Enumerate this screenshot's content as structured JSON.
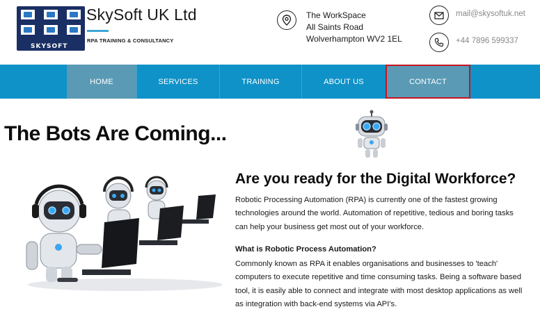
{
  "header": {
    "logo_word": "SKYSOFT",
    "brand_name": "SkySoft UK Ltd",
    "brand_tagline": "RPA TRAINING & CONSULTANCY",
    "address": [
      "The WorkSpace",
      "All Saints Road",
      "Wolverhampton WV2 1EL"
    ],
    "email": "mail@skysoftuk.net",
    "phone": "+44 7896 599337"
  },
  "nav": {
    "items": [
      {
        "label": "HOME",
        "state": "active"
      },
      {
        "label": "SERVICES",
        "state": "normal"
      },
      {
        "label": "TRAINING",
        "state": "normal"
      },
      {
        "label": "ABOUT US",
        "state": "normal"
      },
      {
        "label": "CONTACT",
        "state": "highlighted"
      }
    ]
  },
  "main": {
    "hero_title": "The Bots Are Coming...",
    "section_title": "Are you ready for the Digital Workforce?",
    "paragraph1_lines": [
      "Robotic Processing Automation (RPA) is currently one of the fastest growing",
      "technologies around the world. Automation of repetitive, tedious and boring tasks",
      "can help your business get most out of your workforce."
    ],
    "subheading": "What is Robotic Process Automation?",
    "paragraph2_lines": [
      "Commonly known as RPA it  enables organisations and businesses to 'teach'",
      "computers to execute repetitive and time consuming tasks. Being a software based",
      "tool, it is easily able to connect and integrate with most desktop applications as well",
      "as integration with back-end systems via API's."
    ]
  },
  "colors": {
    "nav_bg": "#0f92c8",
    "nav_active_bg": "#5a9ab5",
    "highlight_border": "#c8141e",
    "logo_bg": "#1a2f63",
    "accent": "#3ea5d6"
  },
  "icons": {
    "address": "location-pin-icon",
    "email": "envelope-icon",
    "phone": "phone-icon"
  }
}
